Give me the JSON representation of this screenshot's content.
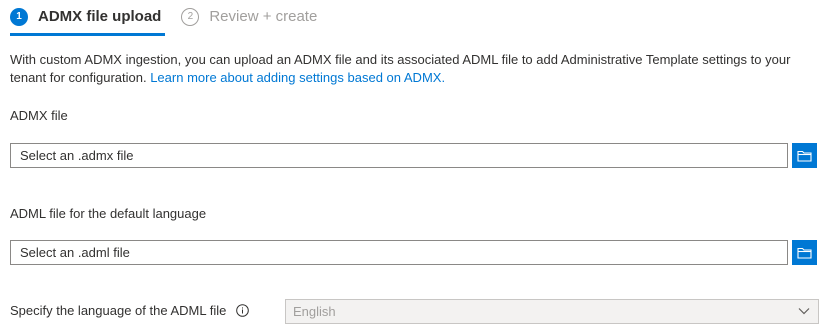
{
  "wizard": {
    "steps": [
      {
        "number": "1",
        "label": "ADMX file upload"
      },
      {
        "number": "2",
        "label": "Review + create"
      }
    ]
  },
  "description": {
    "text": "With custom ADMX ingestion, you can upload an ADMX file and its associated ADML file to add Administrative Template settings to your tenant for configuration. ",
    "link": "Learn more about adding settings based on ADMX."
  },
  "admx": {
    "label": "ADMX file",
    "placeholder": "Select an .admx file"
  },
  "adml": {
    "label": "ADML file for the default language",
    "placeholder": "Select an .adml file"
  },
  "language": {
    "label": "Specify the language of the ADML file",
    "value": "English"
  },
  "colors": {
    "accent": "#0078d4",
    "text": "#323130",
    "disabled_text": "#a19f9d"
  },
  "icons": {
    "browse": "folder-icon",
    "info": "info-icon",
    "dropdown": "chevron-down-icon"
  }
}
